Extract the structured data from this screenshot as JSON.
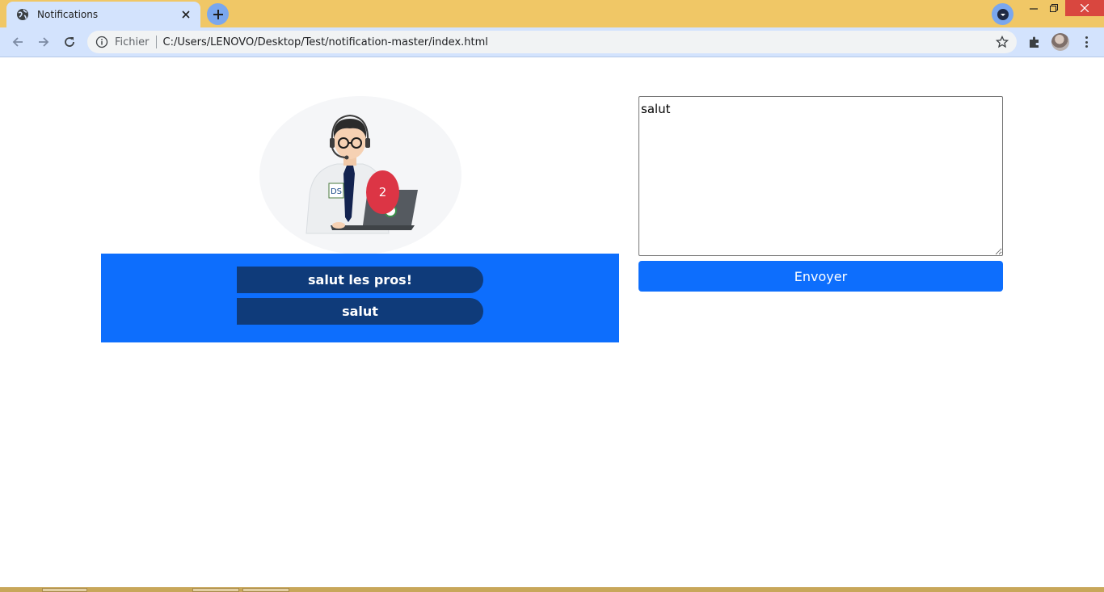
{
  "browser": {
    "tab": {
      "title": "Notifications",
      "favicon": "globe-icon",
      "close_icon": "close-icon"
    },
    "new_tab_icon": "plus-icon",
    "profile_dropdown_icon": "chevron-down-icon",
    "window_controls": [
      "minimize-icon",
      "restore-icon",
      "close-icon"
    ],
    "omnibox": {
      "info_icon": "info-icon",
      "scheme_label": "Fichier",
      "url": "C:/Users/LENOVO/Desktop/Test/notification-master/index.html",
      "bookmark_icon": "star-icon"
    },
    "toolbar_icons": [
      "back-arrow-icon",
      "forward-arrow-icon",
      "reload-icon",
      "extensions-icon",
      "avatar",
      "more-menu-icon"
    ]
  },
  "page": {
    "illustration": "support-agent-with-laptop",
    "notification_count": "2",
    "notifications": [
      {
        "text": "salut les pros!"
      },
      {
        "text": "salut"
      }
    ],
    "message_input": {
      "value": "salut"
    },
    "send_button_label": "Envoyer"
  },
  "colors": {
    "title_bar": "#f0c766",
    "toolbar": "#d3e3fd",
    "primary": "#0d6efd",
    "notification_item": "#0f3b7a",
    "badge": "#dc3545",
    "window_close": "#d9473f"
  }
}
